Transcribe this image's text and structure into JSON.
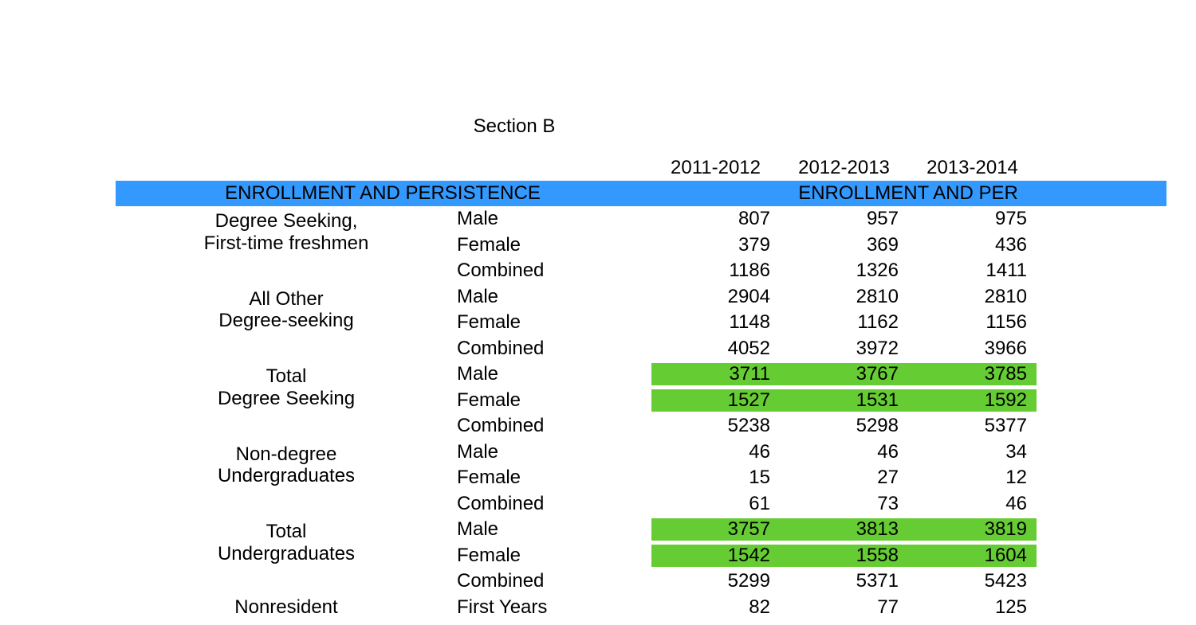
{
  "chart_data": {
    "type": "table",
    "title": "Section B",
    "columns": [
      "2011-2012",
      "2012-2013",
      "2013-2014"
    ],
    "banner_left": "ENROLLMENT AND PERSISTENCE",
    "banner_right": "ENROLLMENT AND PER",
    "groups": [
      {
        "label_line1": "Degree Seeking,",
        "label_line2": "First-time freshmen",
        "rows": [
          {
            "sub": "Male",
            "values": [
              807,
              957,
              975
            ],
            "highlight": false
          },
          {
            "sub": "Female",
            "values": [
              379,
              369,
              436
            ],
            "highlight": false
          },
          {
            "sub": "Combined",
            "values": [
              1186,
              1326,
              1411
            ],
            "highlight": false
          }
        ]
      },
      {
        "label_line1": "All Other",
        "label_line2": "Degree-seeking",
        "rows": [
          {
            "sub": "Male",
            "values": [
              2904,
              2810,
              2810
            ],
            "highlight": false
          },
          {
            "sub": "Female",
            "values": [
              1148,
              1162,
              1156
            ],
            "highlight": false
          },
          {
            "sub": "Combined",
            "values": [
              4052,
              3972,
              3966
            ],
            "highlight": false
          }
        ]
      },
      {
        "label_line1": "Total",
        "label_line2": "Degree Seeking",
        "rows": [
          {
            "sub": "Male",
            "values": [
              3711,
              3767,
              3785
            ],
            "highlight": true
          },
          {
            "sub": "Female",
            "values": [
              1527,
              1531,
              1592
            ],
            "highlight": true
          },
          {
            "sub": "Combined",
            "values": [
              5238,
              5298,
              5377
            ],
            "highlight": false
          }
        ]
      },
      {
        "label_line1": "Non-degree",
        "label_line2": "Undergraduates",
        "rows": [
          {
            "sub": "Male",
            "values": [
              46,
              46,
              34
            ],
            "highlight": false
          },
          {
            "sub": "Female",
            "values": [
              15,
              27,
              12
            ],
            "highlight": false
          },
          {
            "sub": "Combined",
            "values": [
              61,
              73,
              46
            ],
            "highlight": false
          }
        ]
      },
      {
        "label_line1": "Total",
        "label_line2": "Undergraduates",
        "rows": [
          {
            "sub": "Male",
            "values": [
              3757,
              3813,
              3819
            ],
            "highlight": true
          },
          {
            "sub": "Female",
            "values": [
              1542,
              1558,
              1604
            ],
            "highlight": true
          },
          {
            "sub": "Combined",
            "values": [
              5299,
              5371,
              5423
            ],
            "highlight": false
          }
        ]
      },
      {
        "label_line1": "Nonresident",
        "label_line2": "",
        "rows": [
          {
            "sub": "First Years",
            "values": [
              82,
              77,
              125
            ],
            "highlight": false
          }
        ]
      }
    ]
  }
}
